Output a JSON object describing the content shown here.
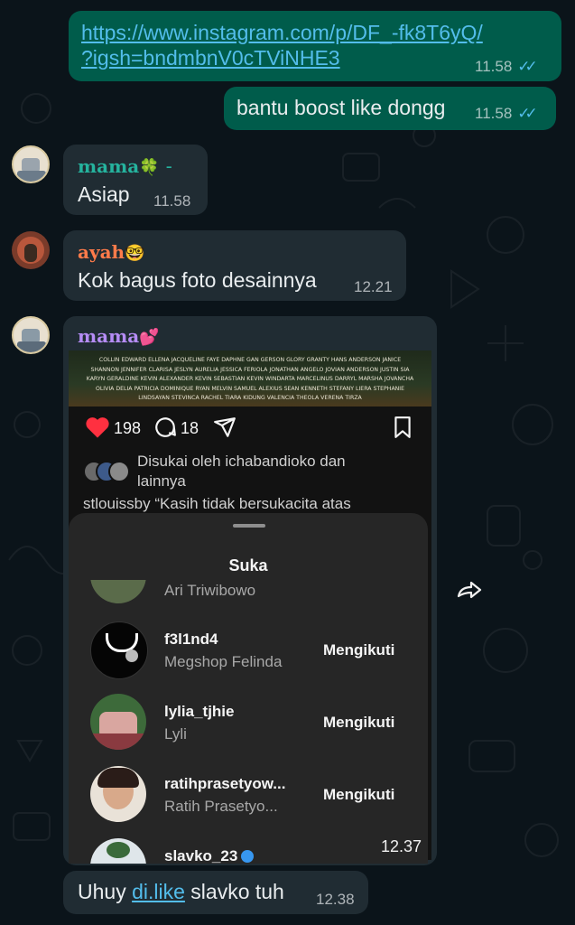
{
  "messages": {
    "link_message": {
      "line1": "https://www.instagram.com/p/DF_-fk8T6yQ/",
      "line2": "?igsh=bndmbnV0cTViNHE3",
      "time": "11.58"
    },
    "boost_message": {
      "text": "bantu boost like dongg",
      "time": "11.58"
    },
    "mama_reply": {
      "sender": "mama",
      "emoji": "🍀",
      "suffix": "-",
      "text": "Asiap",
      "time": "11.58"
    },
    "ayah_reply": {
      "sender": "ayah",
      "emoji": "🤓",
      "text": "Kok bagus foto desainnya",
      "time": "12.21"
    },
    "mama_screenshot": {
      "sender": "mama",
      "emoji": "💕",
      "time": "12.37"
    },
    "last_message": {
      "prefix": "Uhuy ",
      "link": "di.like",
      "suffix": " slavko tuh",
      "time": "12.38"
    }
  },
  "instagram_post": {
    "likes": "198",
    "comments": "18",
    "liked_by_line1": "Disukai oleh ichabandioko dan",
    "liked_by_line2": "lainnya",
    "caption": "stlouissby “Kasih tidak bersukacita atas",
    "poster_names": [
      "COLLIN EDWARD  ELLENA JACQUELINE  FAYE DAPHNE  GAN GERSON  GLORY GRANTY  HANS ANDERSON  JANICE",
      "SHANNON  JENNIFER CLARISA  JESLYN AURELIA  JESSICA FERIOLA  JONATHAN ANGELO  JOVIAN ANDERSON  JUSTIN SIA",
      "KARYN GERALDINE  KEVIN ALEXANDER  KEVIN SEBASTIAN  KEVIN WINDARTA  MARCELINUS DARRYL  MARSHA JOVANCHA",
      "OLIVIA DELIA  PATRICIA DOMINIQUE  RYAN MELVIN  SAMUEL ALEXIUS  SEAN KENNETH  STEFANY LIERA  STEPHANIE",
      "LINDSAYAN  STEVINCA RACHEL  TIARA KIDUNG  VALENCIA THEOLA  VERENA TIRZA"
    ]
  },
  "likes_sheet": {
    "title": "Suka",
    "partial_top": "Ari Triwibowo",
    "rows": [
      {
        "username": "f3l1nd4",
        "name": "Megshop Felinda",
        "button": "Mengikuti"
      },
      {
        "username": "lylia_tjhie",
        "name": "Lyli",
        "button": "Mengikuti"
      },
      {
        "username": "ratihprasetyow...",
        "name": "Ratih Prasetyo...",
        "button": "Mengikuti"
      }
    ],
    "partial_bottom": "slavko_23"
  },
  "colors": {
    "outgoing_bubble": "#005c4b",
    "incoming_bubble": "#202c33",
    "read_ticks": "#53bdeb",
    "mama_name": "#25b39e",
    "ayah_name": "#ff7b4a",
    "mama2_name": "#b58cf5"
  }
}
